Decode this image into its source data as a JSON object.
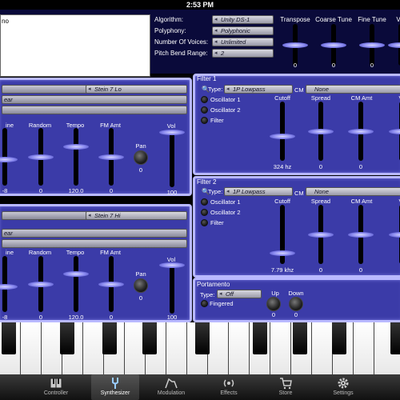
{
  "status": {
    "time": "2:53 PM"
  },
  "preset": {
    "name": "no"
  },
  "algorithm": {
    "labels": [
      "Algorithm:",
      "Polyphony:",
      "Number Of Voices:",
      "Pitch Bend Range:"
    ],
    "values": [
      "Unity DS-1",
      "Polyphonic",
      "Unlimited",
      "2"
    ]
  },
  "master": {
    "labels": [
      "Transpose",
      "Coarse Tune",
      "Fine Tune",
      "V"
    ],
    "values": [
      "0",
      "0",
      "0",
      ""
    ],
    "levels": [
      0.5,
      0.5,
      0.5,
      0.5
    ]
  },
  "osc1": {
    "bars": [
      "",
      "ear",
      ""
    ],
    "wave": "Stein 7 Lo",
    "labels": [
      "ine",
      "Random",
      "Tempo",
      "FM Amt",
      "Pan",
      "Vol"
    ],
    "values": [
      "-8",
      "0",
      "120.0",
      "0",
      "0",
      "100"
    ],
    "levels": [
      0.55,
      0.5,
      0.3,
      0.5,
      0.0
    ]
  },
  "osc2": {
    "bars": [
      "",
      "ear",
      ""
    ],
    "wave": "Stein 7 Hi",
    "labels": [
      "ine",
      "Random",
      "Tempo",
      "FM Amt",
      "Pan",
      "Vol"
    ],
    "values": [
      "-8",
      "0",
      "120.0",
      "0",
      "0",
      "100"
    ],
    "levels": [
      0.55,
      0.5,
      0.3,
      0.5,
      0.0
    ]
  },
  "filter1": {
    "title": "Filter 1",
    "type_label": "Type:",
    "type_value": "1P Lowpass",
    "cm_label": "CM",
    "cm_value": "None",
    "routes": [
      "Oscillator 1",
      "Oscillator 2",
      "Filter"
    ],
    "labels": [
      "Cutoff",
      "Spread",
      "CM Amt",
      "V"
    ],
    "values": [
      "324 hz",
      "0",
      "0",
      "0"
    ],
    "levels": [
      0.6,
      0.5,
      0.5,
      0.5
    ]
  },
  "filter2": {
    "title": "Filter 2",
    "type_label": "Type:",
    "type_value": "1P Lowpass",
    "cm_label": "CM",
    "cm_value": "None",
    "routes": [
      "Oscillator 1",
      "Oscillator 2",
      "Filter"
    ],
    "labels": [
      "Cutoff",
      "Spread",
      "CM Amt",
      "V"
    ],
    "values": [
      "7.79 khz",
      "0",
      "0",
      "0"
    ],
    "levels": [
      0.85,
      0.5,
      0.5,
      0.5
    ]
  },
  "portamento": {
    "title": "Portamento",
    "type_label": "Type:",
    "type_value": "Off",
    "fingered": "Fingered",
    "up_label": "Up",
    "down_label": "Down",
    "up_value": "0",
    "down_value": "0"
  },
  "tabs": [
    {
      "label": "Controller",
      "icon": "piano-keys-icon"
    },
    {
      "label": "Synthesizer",
      "icon": "tuning-fork-icon"
    },
    {
      "label": "Modulation",
      "icon": "envelope-icon"
    },
    {
      "label": "Effects",
      "icon": "speaker-waves-icon"
    },
    {
      "label": "Store",
      "icon": "cart-icon"
    },
    {
      "label": "Settings",
      "icon": "gear-icon"
    }
  ],
  "selected_tab": "Synthesizer",
  "colors": {
    "panel": "#3b3ba8",
    "panel_border": "#b9b9ff",
    "background": "#0a0a3a"
  }
}
